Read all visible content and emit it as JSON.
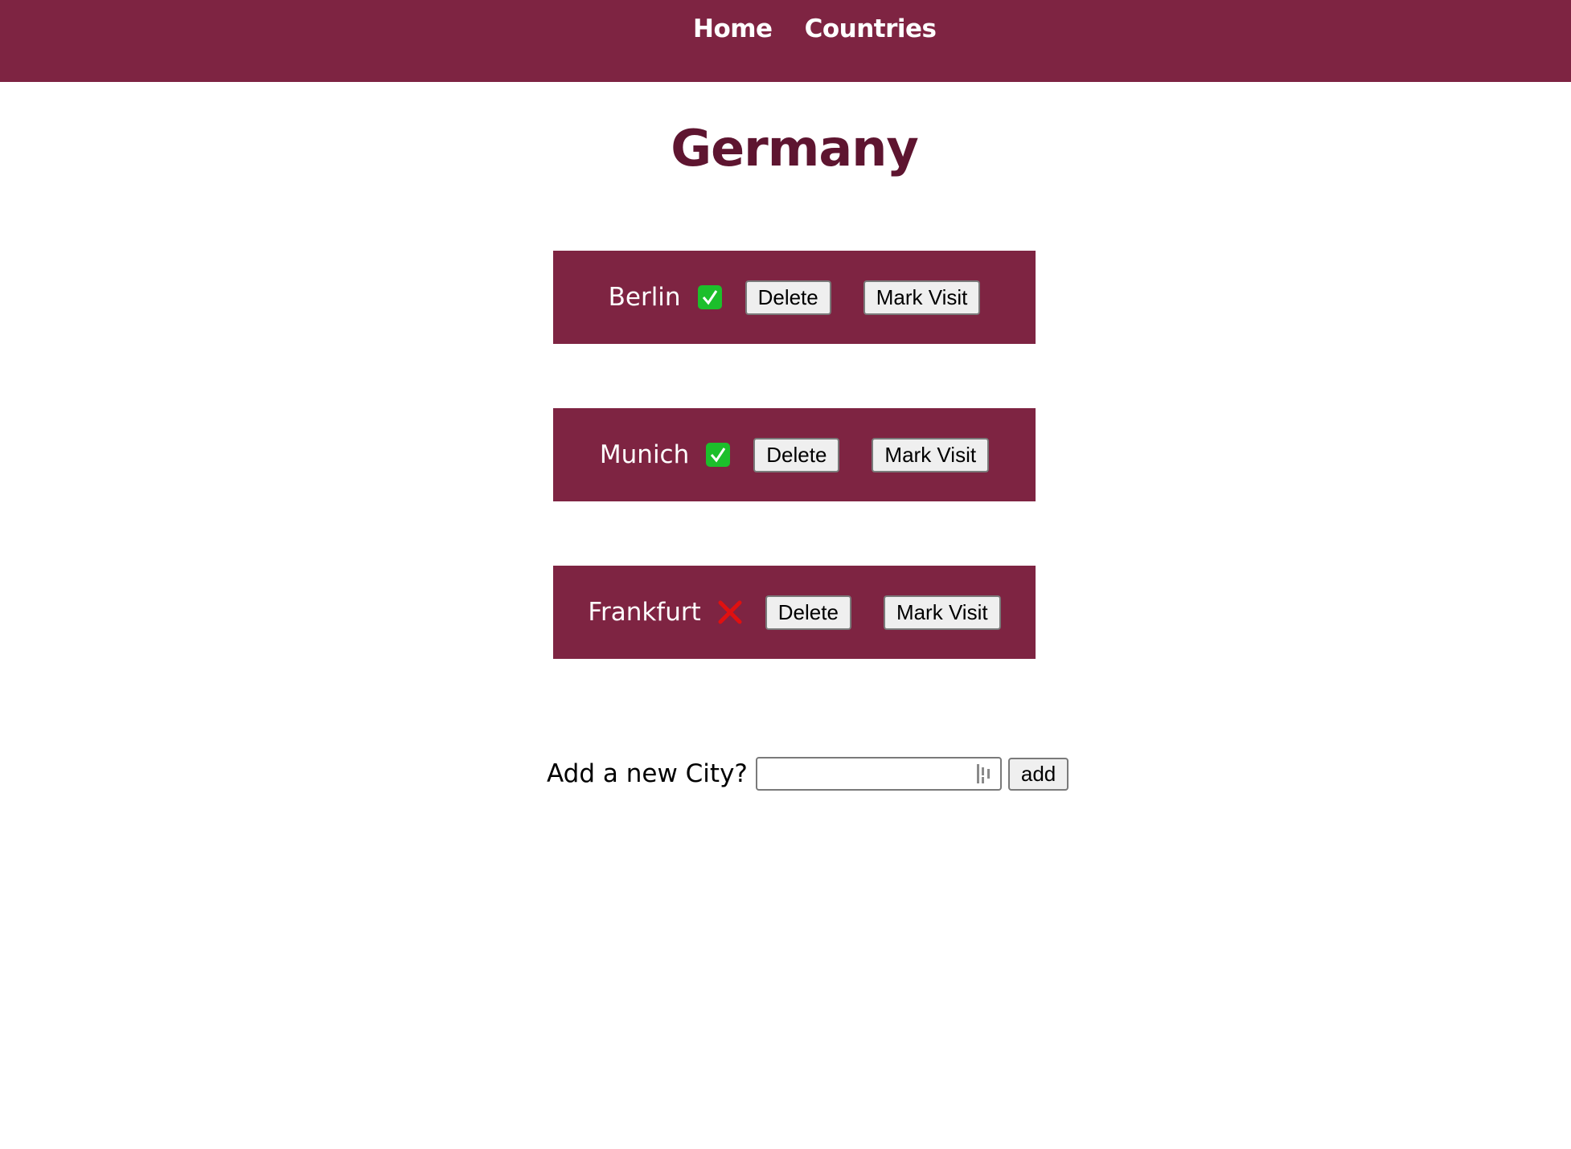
{
  "nav": {
    "links": [
      {
        "label": "Home"
      },
      {
        "label": "Countries"
      }
    ]
  },
  "page": {
    "title": "Germany"
  },
  "cities": [
    {
      "name": "Berlin",
      "visited": true,
      "status_icon": "check-mark-icon",
      "delete_label": "Delete",
      "mark_label": "Mark Visit"
    },
    {
      "name": "Munich",
      "visited": true,
      "status_icon": "check-mark-icon",
      "delete_label": "Delete",
      "mark_label": "Mark Visit"
    },
    {
      "name": "Frankfurt",
      "visited": false,
      "status_icon": "cross-mark-icon",
      "delete_label": "Delete",
      "mark_label": "Mark Visit"
    }
  ],
  "add_city": {
    "label": "Add a new City?",
    "input_value": "",
    "input_placeholder": "",
    "button_label": "add"
  },
  "colors": {
    "primary": "#7e2442",
    "title": "#5e1530",
    "visited_green": "#1cbf2b",
    "not_visited_red": "#e01010"
  }
}
